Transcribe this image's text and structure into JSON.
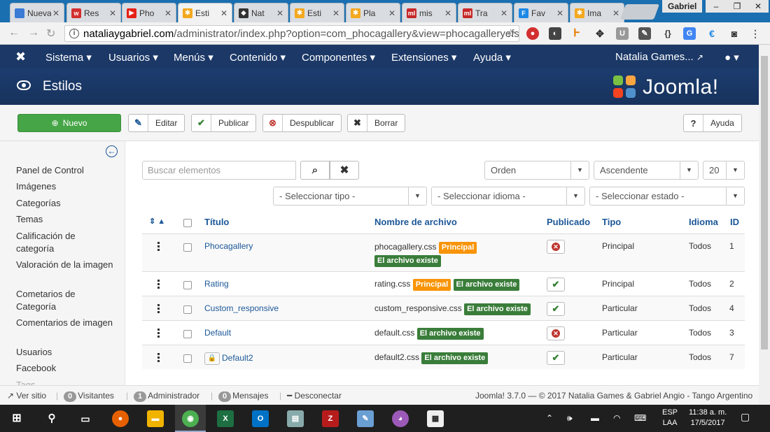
{
  "browser": {
    "tabs": [
      {
        "label": "Nueva",
        "color": "#3a7bd5",
        "glyph": ""
      },
      {
        "label": "Res",
        "color": "#d32f2f",
        "glyph": "w"
      },
      {
        "label": "Pho",
        "color": "#e62117",
        "glyph": "▶"
      },
      {
        "label": "Esti",
        "color": "#f4a81d",
        "glyph": "✱"
      },
      {
        "label": "Nat",
        "color": "#333333",
        "glyph": "◆"
      },
      {
        "label": "Esti",
        "color": "#f4a81d",
        "glyph": "✱"
      },
      {
        "label": "Pla",
        "color": "#f4a81d",
        "glyph": "✱"
      },
      {
        "label": "mis",
        "color": "#c62828",
        "glyph": "ml"
      },
      {
        "label": "Tra",
        "color": "#c62828",
        "glyph": "ml"
      },
      {
        "label": "Fav",
        "color": "#1e88e5",
        "glyph": "F"
      },
      {
        "label": "Ima",
        "color": "#f4a81d",
        "glyph": "✱"
      }
    ],
    "window_user": "Gabriel",
    "url_domain": "nataliaygabriel.com",
    "url_rest": "/administrator/index.php?option=com_phocagallery&view=phocagalleryefs"
  },
  "nav": {
    "items": [
      "Sistema ▾",
      "Usuarios ▾",
      "Menús ▾",
      "Contenido ▾",
      "Componentes ▾",
      "Extensiones ▾",
      "Ayuda ▾"
    ],
    "site_name": "Natalia Games...",
    "site_icon": "external-link-icon",
    "user_icon": "user-icon"
  },
  "header": {
    "title": "Estilos",
    "logo_text": "Joomla!"
  },
  "toolbar": {
    "new": "Nuevo",
    "edit": "Editar",
    "publish": "Publicar",
    "unpublish": "Despublicar",
    "delete": "Borrar",
    "help": "Ayuda"
  },
  "sidebar": {
    "items": [
      "Panel de Control",
      "Imágenes",
      "Categorías",
      "Temas",
      "Calificación de categoría",
      "Valoración de la imagen",
      "Cometarios de Categoría",
      "Comentarios de imagen",
      "Usuarios",
      "Facebook",
      "Tags"
    ]
  },
  "filters": {
    "search_placeholder": "Buscar elementos",
    "order": "Orden",
    "direction": "Ascendente",
    "limit": "20",
    "type": "- Seleccionar tipo -",
    "language": "- Seleccionar idioma -",
    "state": "- Seleccionar estado -"
  },
  "table": {
    "sort_glyph": "⇕ ▲",
    "headers": {
      "title": "Título",
      "filename": "Nombre de archivo",
      "published": "Publicado",
      "type": "Tipo",
      "language": "Idioma",
      "id": "ID"
    },
    "badge_main": "Principal",
    "badge_exists": "El archivo existe",
    "rows": [
      {
        "title": "Phocagallery",
        "filename": "phocagallery.css",
        "main": true,
        "published": false,
        "type": "Principal",
        "language": "Todos",
        "id": "1",
        "locked": false
      },
      {
        "title": "Rating",
        "filename": "rating.css",
        "main": true,
        "published": true,
        "type": "Principal",
        "language": "Todos",
        "id": "2",
        "locked": false
      },
      {
        "title": "Custom_responsive",
        "filename": "custom_responsive.css",
        "main": false,
        "published": true,
        "type": "Particular",
        "language": "Todos",
        "id": "4",
        "locked": false
      },
      {
        "title": "Default",
        "filename": "default.css",
        "main": false,
        "published": false,
        "type": "Particular",
        "language": "Todos",
        "id": "3",
        "locked": false
      },
      {
        "title": "Default2",
        "filename": "default2.css",
        "main": false,
        "published": true,
        "type": "Particular",
        "language": "Todos",
        "id": "7",
        "locked": true
      }
    ]
  },
  "status": {
    "view_site": "Ver sitio",
    "visitors_count": "0",
    "visitors": "Visitantes",
    "admin_count": "1",
    "admin": "Administrador",
    "messages_count": "0",
    "messages": "Mensajes",
    "logout": "Desconectar",
    "footer": "Joomla! 3.7.0 — © 2017 Natalia Games & Gabriel Angio - Tango Argentino"
  },
  "taskbar": {
    "lang_top": "ESP",
    "lang_bottom": "LAA",
    "time": "11:38 a. m.",
    "date": "17/5/2017"
  }
}
